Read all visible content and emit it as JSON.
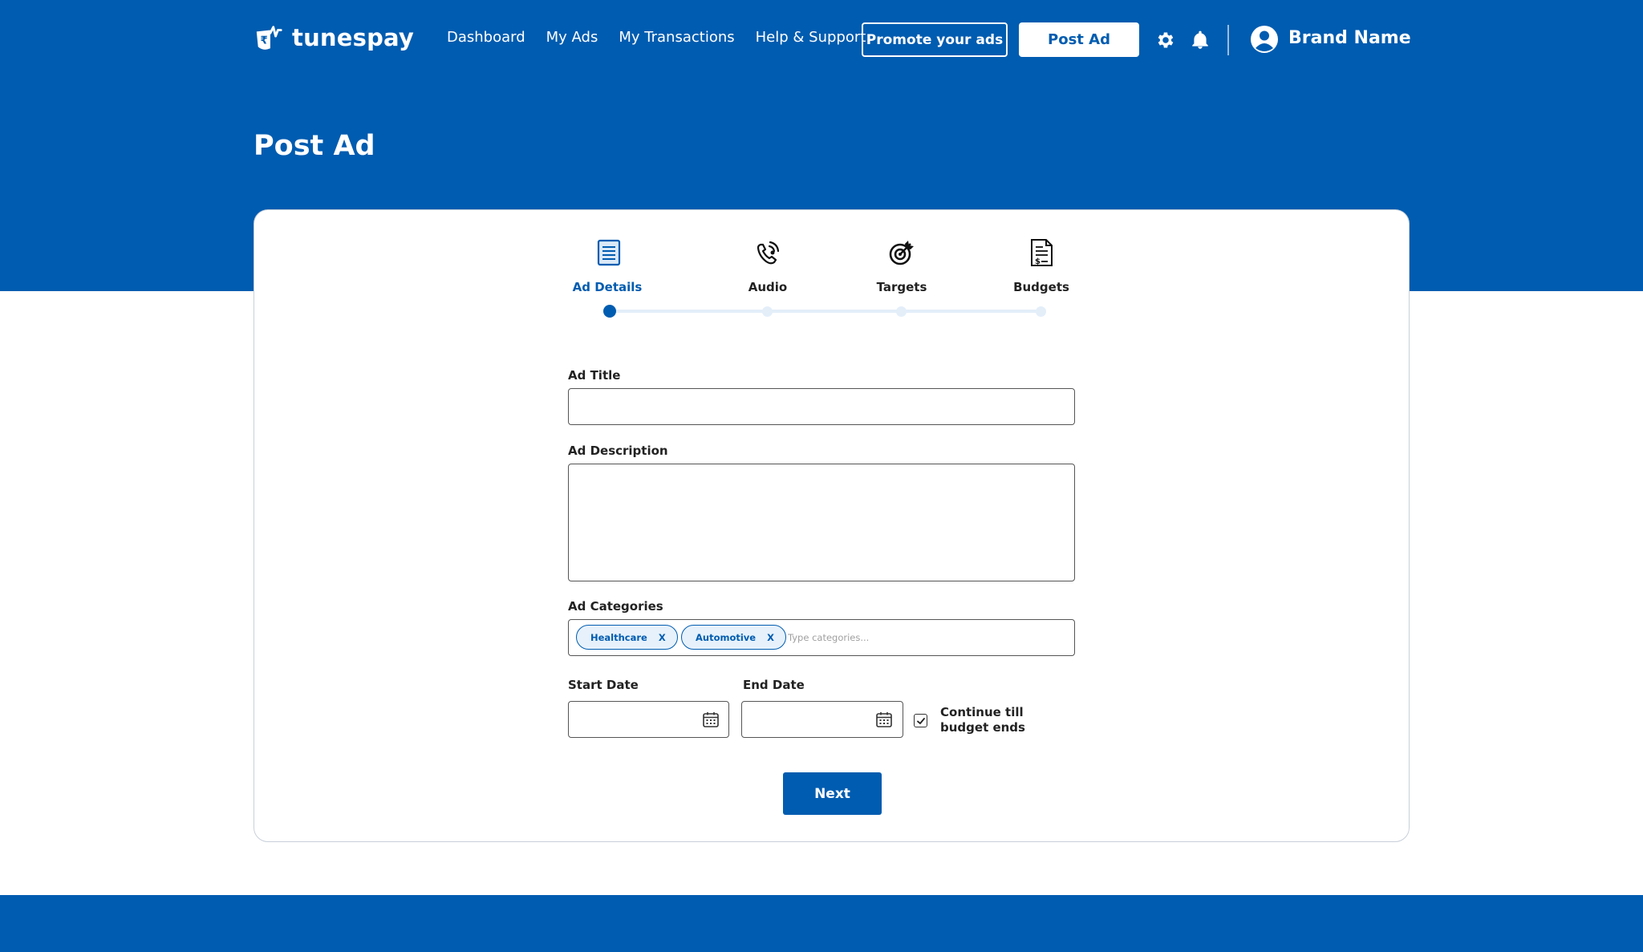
{
  "header": {
    "logo_text": "tunespay",
    "nav": [
      "Dashboard",
      "My Ads",
      "My Transactions",
      "Help & Support"
    ],
    "promote_label": "Promote your ads",
    "post_ad_label": "Post Ad",
    "brand_name": "Brand Name"
  },
  "page": {
    "title": "Post Ad"
  },
  "steps": [
    {
      "label": "Ad Details",
      "icon": "document-icon",
      "active": true
    },
    {
      "label": "Audio",
      "icon": "phone-audio-icon",
      "active": false
    },
    {
      "label": "Targets",
      "icon": "target-icon",
      "active": false
    },
    {
      "label": "Budgets",
      "icon": "budget-document-icon",
      "active": false
    }
  ],
  "form": {
    "ad_title_label": "Ad Title",
    "ad_title_value": "",
    "ad_description_label": "Ad Description",
    "ad_description_value": "",
    "ad_categories_label": "Ad Categories",
    "categories": [
      "Healthcare",
      "Automotive"
    ],
    "chip_remove": "X",
    "categories_placeholder": "Type categories...",
    "start_date_label": "Start Date",
    "start_date_value": "",
    "end_date_label": "End Date",
    "end_date_value": "",
    "continue_label": "Continue till budget ends",
    "continue_checked": true,
    "next_label": "Next"
  },
  "colors": {
    "brand_blue": "#005cb0",
    "light_blue": "#e3eef9",
    "white": "#ffffff"
  }
}
